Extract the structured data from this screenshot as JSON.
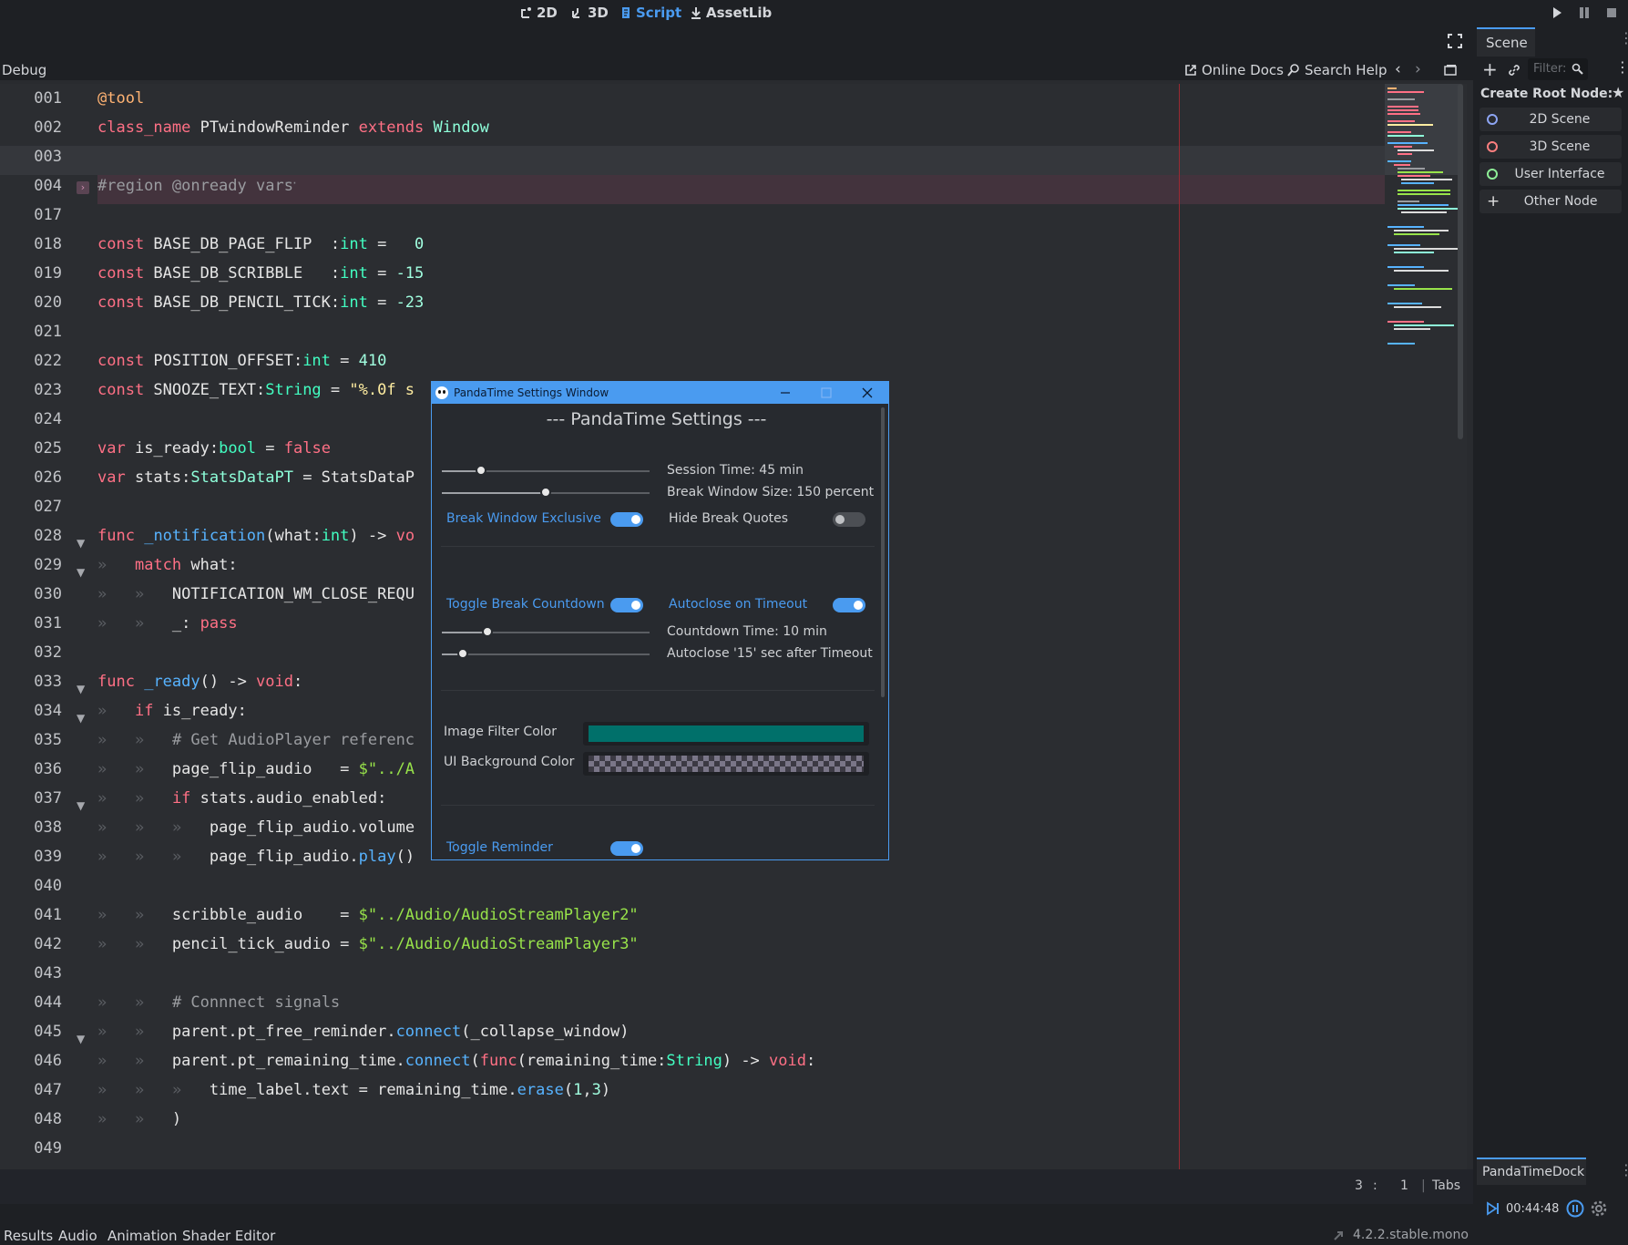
{
  "top_tabs": [
    {
      "label": "2D",
      "icon": "2d-icon"
    },
    {
      "label": "3D",
      "icon": "3d-icon"
    },
    {
      "label": "Script",
      "icon": "script-icon",
      "active": true
    },
    {
      "label": "AssetLib",
      "icon": "download-icon"
    }
  ],
  "toolbar": {
    "debug_label": "Debug",
    "online_docs": "Online Docs",
    "search_help": "Search Help"
  },
  "code_lines": [
    {
      "n": "001",
      "html": "<span class='an'>@tool</span>"
    },
    {
      "n": "002",
      "html": "<span class='kw'>class_name</span> PTwindowReminder <span class='kw'>extends</span> <span class='cls'>Window</span>"
    },
    {
      "n": "003",
      "html": ""
    },
    {
      "n": "004",
      "html": "<span class='cm'>#region @onready vars</span>"
    },
    {
      "n": "017",
      "html": ""
    },
    {
      "n": "018",
      "html": "<span class='kw'>const</span> BASE_DB_PAGE_FLIP  :<span class='tp'>int</span> =   <span class='num'>0</span>"
    },
    {
      "n": "019",
      "html": "<span class='kw'>const</span> BASE_DB_SCRIBBLE   :<span class='tp'>int</span> = <span class='num'>-15</span>"
    },
    {
      "n": "020",
      "html": "<span class='kw'>const</span> BASE_DB_PENCIL_TICK:<span class='tp'>int</span> = <span class='num'>-23</span>"
    },
    {
      "n": "021",
      "html": ""
    },
    {
      "n": "022",
      "html": "<span class='kw'>const</span> POSITION_OFFSET:<span class='tp'>int</span> = <span class='num'>410</span>"
    },
    {
      "n": "023",
      "html": "<span class='kw'>const</span> SNOOZE_TEXT:<span class='tp'>String</span> = <span class='str'>\"%.0f s</span>"
    },
    {
      "n": "024",
      "html": ""
    },
    {
      "n": "025",
      "html": "<span class='kw'>var</span> is_ready:<span class='tp'>bool</span> = <span class='kw'>false</span>"
    },
    {
      "n": "026",
      "html": "<span class='kw'>var</span> stats:<span class='cls'>StatsDataPT</span> = StatsDataP"
    },
    {
      "n": "027",
      "html": ""
    },
    {
      "n": "028",
      "html": "<span class='kw'>func</span> <span class='fn'>_notification</span>(what:<span class='tp'>int</span>) -> <span class='kw'>vo</span>"
    },
    {
      "n": "029",
      "html": "<span class='tabmark'>»</span>   <span class='kw'>match</span> what:"
    },
    {
      "n": "030",
      "html": "<span class='tabmark'>»</span>   <span class='tabmark'>»</span>   NOTIFICATION_WM_CLOSE_REQU"
    },
    {
      "n": "031",
      "html": "<span class='tabmark'>»</span>   <span class='tabmark'>»</span>   _: <span class='kw'>pass</span>"
    },
    {
      "n": "032",
      "html": ""
    },
    {
      "n": "033",
      "html": "<span class='kw'>func</span> <span class='fn'>_ready</span>() -> <span class='kw'>void</span>:"
    },
    {
      "n": "034",
      "html": "<span class='tabmark'>»</span>   <span class='kw'>if</span> is_ready:"
    },
    {
      "n": "035",
      "html": "<span class='tabmark'>»</span>   <span class='tabmark'>»</span>   <span class='cm'># Get AudioPlayer referenc</span>"
    },
    {
      "n": "036",
      "html": "<span class='tabmark'>»</span>   <span class='tabmark'>»</span>   page_flip_audio   = <span class='str2'>$\"../A</span>"
    },
    {
      "n": "037",
      "html": "<span class='tabmark'>»</span>   <span class='tabmark'>»</span>   <span class='kw'>if</span> stats.audio_enabled:"
    },
    {
      "n": "038",
      "html": "<span class='tabmark'>»</span>   <span class='tabmark'>»</span>   <span class='tabmark'>»</span>   page_flip_audio.volume"
    },
    {
      "n": "039",
      "html": "<span class='tabmark'>»</span>   <span class='tabmark'>»</span>   <span class='tabmark'>»</span>   page_flip_audio.<span class='fn'>play</span>()"
    },
    {
      "n": "040",
      "html": ""
    },
    {
      "n": "041",
      "html": "<span class='tabmark'>»</span>   <span class='tabmark'>»</span>   scribble_audio    = <span class='str2'>$\"../Audio/AudioStreamPlayer2\"</span>"
    },
    {
      "n": "042",
      "html": "<span class='tabmark'>»</span>   <span class='tabmark'>»</span>   pencil_tick_audio = <span class='str2'>$\"../Audio/AudioStreamPlayer3\"</span>"
    },
    {
      "n": "043",
      "html": ""
    },
    {
      "n": "044",
      "html": "<span class='tabmark'>»</span>   <span class='tabmark'>»</span>   <span class='cm'># Connnect signals</span>"
    },
    {
      "n": "045",
      "html": "<span class='tabmark'>»</span>   <span class='tabmark'>»</span>   parent.pt_free_reminder.<span class='fn'>connect</span>(_collapse_window)"
    },
    {
      "n": "046",
      "html": "<span class='tabmark'>»</span>   <span class='tabmark'>»</span>   parent.pt_remaining_time.<span class='fn'>connect</span>(<span class='kw'>func</span>(remaining_time:<span class='tp'>String</span>) -> <span class='kw'>void</span>:"
    },
    {
      "n": "047",
      "html": "<span class='tabmark'>»</span>   <span class='tabmark'>»</span>   <span class='tabmark'>»</span>   time_label.text = remaining_time.<span class='fn'>erase</span>(<span class='num'>1</span>,<span class='num'>3</span>)"
    },
    {
      "n": "048",
      "html": "<span class='tabmark'>»</span>   <span class='tabmark'>»</span>   )"
    },
    {
      "n": "049",
      "html": ""
    }
  ],
  "status": {
    "line": "3",
    "sep": ":",
    "col": "1",
    "indent": "Tabs",
    "version": "4.2.2.stable.mono"
  },
  "bottom_tabs": [
    "Results",
    "Audio",
    "Animation",
    "Shader Editor"
  ],
  "scene_dock": {
    "tab": "Scene",
    "filter_placeholder": "Filter:",
    "create_root": "Create Root Node:",
    "nodes": [
      {
        "label": "2D Scene",
        "icon": "circle-blue-icon",
        "color": "#8da5f3"
      },
      {
        "label": "3D Scene",
        "icon": "circle-red-icon",
        "color": "#fc7f7f"
      },
      {
        "label": "User Interface",
        "icon": "circle-green-icon",
        "color": "#8eef97"
      },
      {
        "label": "Other Node",
        "icon": "plus-icon",
        "color": "#e0e0e0"
      }
    ]
  },
  "panda_dock": {
    "tab": "PandaTimeDock",
    "time": "00:44:48"
  },
  "dialog": {
    "title": "PandaTime Settings Window",
    "heading": "--- PandaTime Settings ---",
    "session_time": "Session Time: 45 min",
    "session_value": 0.19,
    "break_size": "Break Window Size: 150 percent",
    "break_size_value": 0.5,
    "break_exclusive": "Break Window Exclusive",
    "break_exclusive_on": true,
    "hide_quotes": "Hide Break Quotes",
    "hide_quotes_on": false,
    "toggle_countdown": "Toggle Break Countdown",
    "toggle_countdown_on": true,
    "autoclose": "Autoclose on Timeout",
    "autoclose_on": true,
    "countdown_time": "Countdown Time: 10 min",
    "countdown_value": 0.22,
    "autoclose_after": "Autoclose '15' sec after Timeout",
    "autoclose_after_value": 0.1,
    "image_filter_label": "Image Filter Color",
    "image_filter_color": "#00706a",
    "ui_bg_label": "UI Background Color",
    "toggle_reminder": "Toggle Reminder",
    "toggle_reminder_on": true
  },
  "colors": {
    "accent": "#4a9bf0",
    "background": "#2b2d31"
  }
}
